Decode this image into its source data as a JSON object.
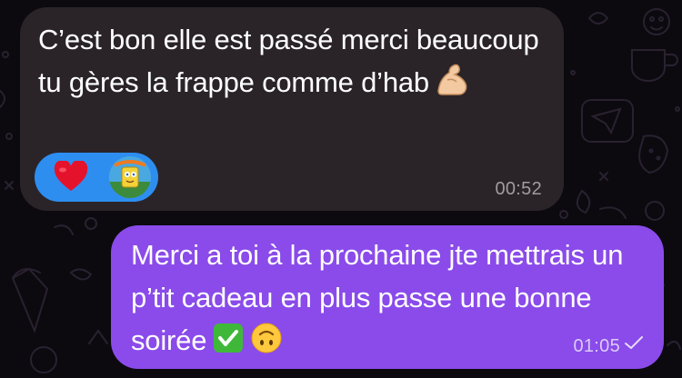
{
  "messages": [
    {
      "direction": "incoming",
      "text": "C’est bon elle est passé merci beaucoup tu gères la frappe comme d’hab",
      "emoji": "flexed-biceps",
      "time": "00:52",
      "reactions": [
        "heart",
        "avatar"
      ]
    },
    {
      "direction": "outgoing",
      "text": "Merci a toi à la prochaine jte mettrais un p’tit cadeau en plus passe une bonne soirée",
      "emojis": [
        "check-mark-button",
        "upside-down-face"
      ],
      "time": "01:05",
      "status": "sent-check"
    }
  ],
  "colors": {
    "background": "#0c0a0f",
    "incoming_bubble": "#2a2429",
    "outgoing_bubble": "#8a4bea",
    "reaction_pill": "#2e8ef0"
  }
}
